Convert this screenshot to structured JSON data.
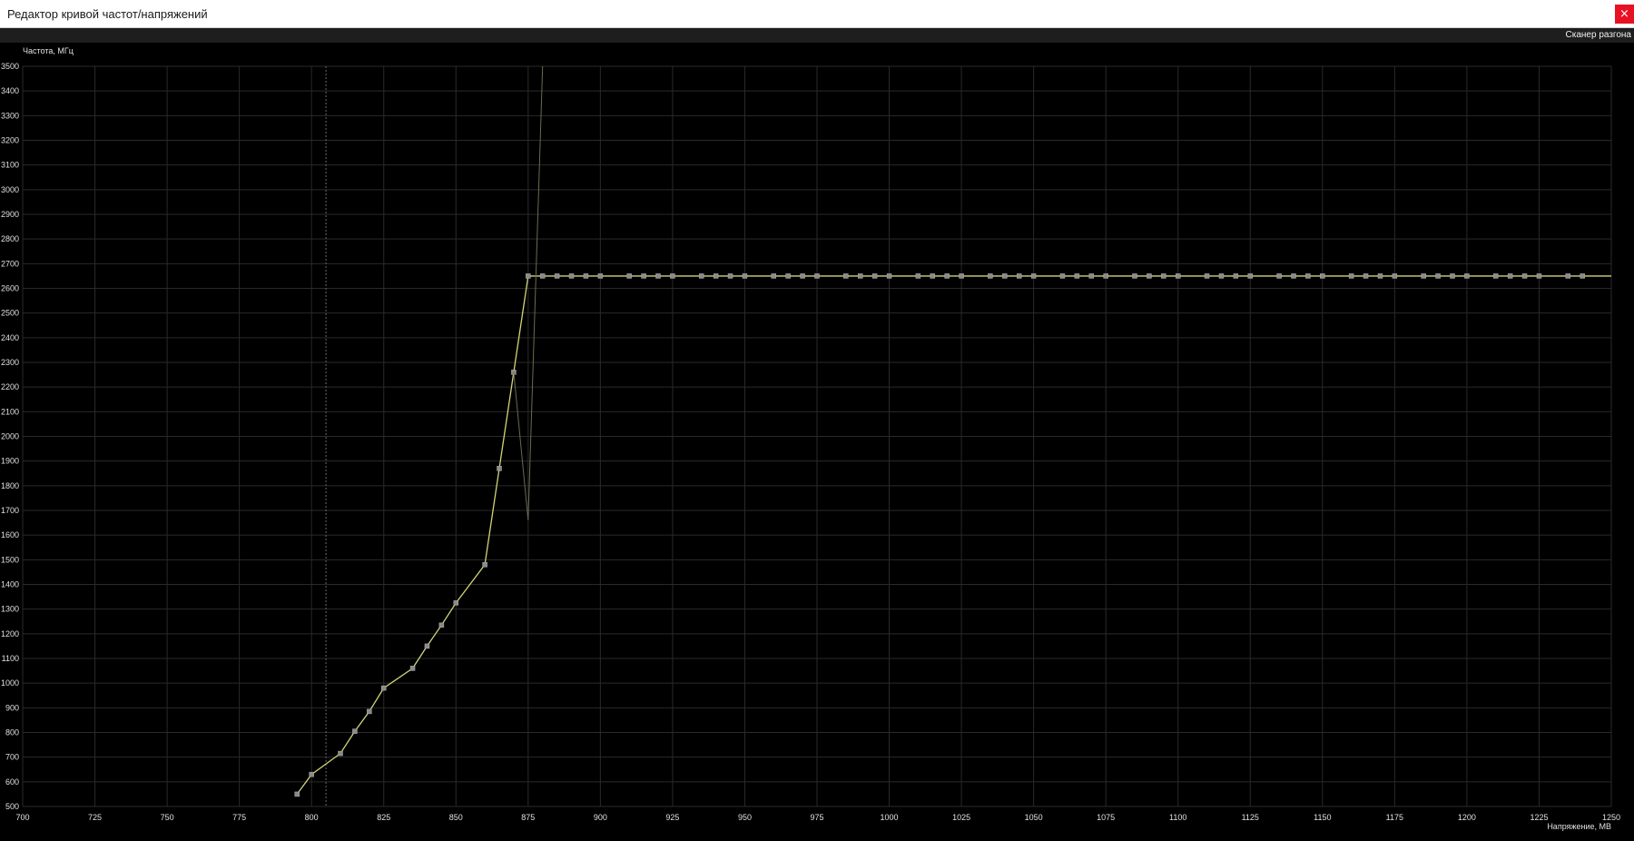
{
  "window": {
    "title": "Редактор кривой частот/напряжений",
    "close_icon": "close-icon",
    "close_glyph": "×",
    "close_color": "#e81123"
  },
  "toolbar": {
    "scanner_label": "Сканер разгона"
  },
  "chart_data": {
    "type": "line",
    "ylabel": "Частота, МГц",
    "xlabel": "Напряжение, МВ",
    "xlim": [
      700,
      1250
    ],
    "ylim": [
      500,
      3500
    ],
    "x_ticks": [
      700,
      725,
      750,
      775,
      800,
      825,
      850,
      875,
      900,
      925,
      950,
      975,
      1000,
      1025,
      1050,
      1075,
      1100,
      1125,
      1150,
      1175,
      1200,
      1225,
      1250
    ],
    "y_ticks": [
      500,
      600,
      700,
      800,
      900,
      1000,
      1100,
      1200,
      1300,
      1400,
      1500,
      1600,
      1700,
      1800,
      1900,
      2000,
      2100,
      2200,
      2300,
      2400,
      2500,
      2600,
      2700,
      2800,
      2900,
      3000,
      3100,
      3200,
      3300,
      3400,
      3500
    ],
    "grid": true,
    "background": "#000000",
    "grid_color": "#2a2a2a",
    "axis_text_color": "#e0e0e0",
    "curve_color": "#d4d47a",
    "point_color": "#8a8a8a",
    "ghost_color": "#6b6b50",
    "marker_line": {
      "x": 805
    },
    "series": [
      {
        "points": [
          [
            795,
            550
          ],
          [
            800,
            630
          ],
          [
            810,
            715
          ],
          [
            815,
            805
          ],
          [
            820,
            885
          ],
          [
            825,
            980
          ],
          [
            835,
            1060
          ],
          [
            840,
            1150
          ],
          [
            845,
            1235
          ],
          [
            850,
            1325
          ],
          [
            860,
            1480
          ],
          [
            865,
            1870
          ],
          [
            870,
            2260
          ],
          [
            875,
            2650
          ],
          [
            880,
            2650
          ],
          [
            885,
            2650
          ],
          [
            890,
            2650
          ],
          [
            895,
            2650
          ],
          [
            900,
            2650
          ],
          [
            910,
            2650
          ],
          [
            915,
            2650
          ],
          [
            920,
            2650
          ],
          [
            925,
            2650
          ],
          [
            935,
            2650
          ],
          [
            940,
            2650
          ],
          [
            945,
            2650
          ],
          [
            950,
            2650
          ],
          [
            960,
            2650
          ],
          [
            965,
            2650
          ],
          [
            970,
            2650
          ],
          [
            975,
            2650
          ],
          [
            985,
            2650
          ],
          [
            990,
            2650
          ],
          [
            995,
            2650
          ],
          [
            1000,
            2650
          ],
          [
            1010,
            2650
          ],
          [
            1015,
            2650
          ],
          [
            1020,
            2650
          ],
          [
            1025,
            2650
          ],
          [
            1035,
            2650
          ],
          [
            1040,
            2650
          ],
          [
            1045,
            2650
          ],
          [
            1050,
            2650
          ],
          [
            1060,
            2650
          ],
          [
            1065,
            2650
          ],
          [
            1070,
            2650
          ],
          [
            1075,
            2650
          ],
          [
            1085,
            2650
          ],
          [
            1090,
            2650
          ],
          [
            1095,
            2650
          ],
          [
            1100,
            2650
          ],
          [
            1110,
            2650
          ],
          [
            1115,
            2650
          ],
          [
            1120,
            2650
          ],
          [
            1125,
            2650
          ],
          [
            1135,
            2650
          ],
          [
            1140,
            2650
          ],
          [
            1145,
            2650
          ],
          [
            1150,
            2650
          ],
          [
            1160,
            2650
          ],
          [
            1165,
            2650
          ],
          [
            1170,
            2650
          ],
          [
            1175,
            2650
          ],
          [
            1185,
            2650
          ],
          [
            1190,
            2650
          ],
          [
            1195,
            2650
          ],
          [
            1200,
            2650
          ],
          [
            1210,
            2650
          ],
          [
            1215,
            2650
          ],
          [
            1220,
            2650
          ],
          [
            1225,
            2650
          ],
          [
            1235,
            2650
          ],
          [
            1240,
            2650
          ]
        ]
      },
      {
        "ghost": true,
        "points": [
          [
            870,
            2260
          ],
          [
            875,
            1660
          ],
          [
            880,
            3500
          ]
        ]
      }
    ]
  }
}
